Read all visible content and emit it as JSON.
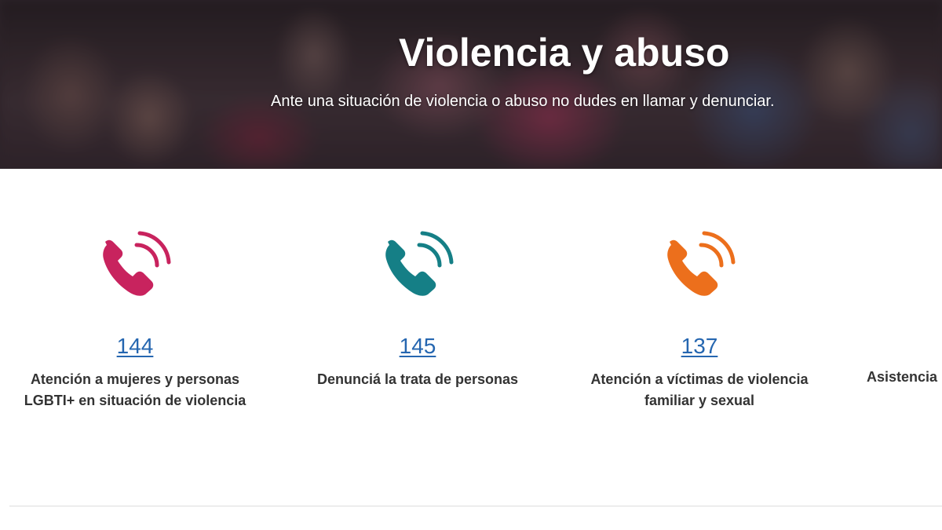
{
  "hero": {
    "title": "Violencia y abuso",
    "subtitle": "Ante una situación de violencia o abuso no dudes en llamar y denunciar."
  },
  "cards": [
    {
      "number": "144",
      "description_line1": "Atención a mujeres y personas",
      "description_line2": "LGBTI+ en situación de violencia",
      "icon": "phone-ringing-icon",
      "color": "#c8235e"
    },
    {
      "number": "145",
      "description_line1": "Denunciá la trata de personas",
      "description_line2": "",
      "icon": "phone-ringing-icon",
      "color": "#157f86"
    },
    {
      "number": "137",
      "description_line1": "Atención a víctimas de violencia",
      "description_line2": "familiar y sexual",
      "icon": "phone-ringing-icon",
      "color": "#ec6f1c"
    },
    {
      "number": "",
      "description_line1": "Asistencia",
      "description_line2": "",
      "icon": "phone-ringing-icon",
      "color": ""
    }
  ],
  "colors": {
    "link": "#2566b0",
    "text": "#333333"
  }
}
